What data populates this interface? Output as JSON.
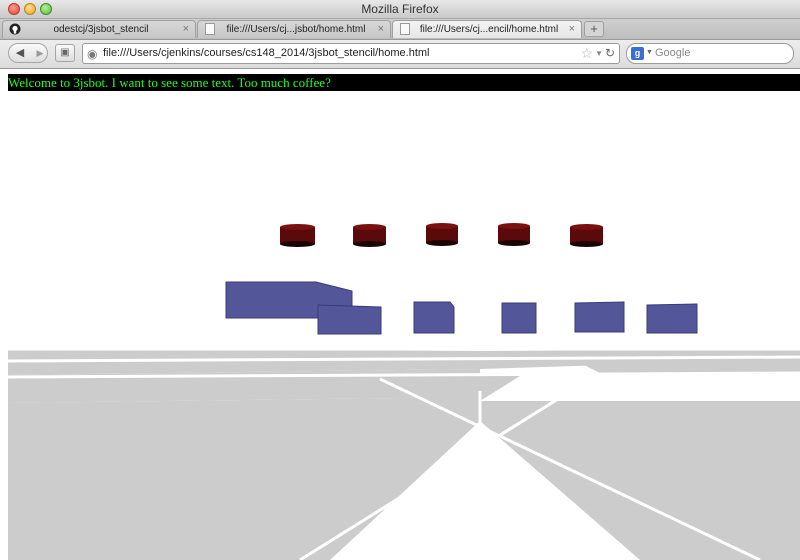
{
  "window": {
    "title": "Mozilla Firefox"
  },
  "tabs": [
    {
      "label": "odestcj/3jsbot_stencil",
      "icon": "github-icon",
      "active": false
    },
    {
      "label": "file:///Users/cj...jsbot/home.html",
      "icon": "page-icon",
      "active": false
    },
    {
      "label": "file:///Users/cj...encil/home.html",
      "icon": "page-icon",
      "active": true
    }
  ],
  "tab_close_glyph": "×",
  "newtab_glyph": "+",
  "nav": {
    "url": "file:///Users/cjenkins/courses/cs148_2014/3jsbot_stencil/home.html",
    "search_placeholder": "Google",
    "search_engine_glyph": "g"
  },
  "page": {
    "banner_text": "Welcome to 3jsbot. I want to see some text. Too much coffee?",
    "colors": {
      "banner_bg": "#000000",
      "banner_text": "#1eff1e",
      "floor_tile": "#cccccc",
      "cylinder": "#5a0a0a",
      "cylinder_top": "#7a1010",
      "box": "#4a4f94"
    }
  }
}
